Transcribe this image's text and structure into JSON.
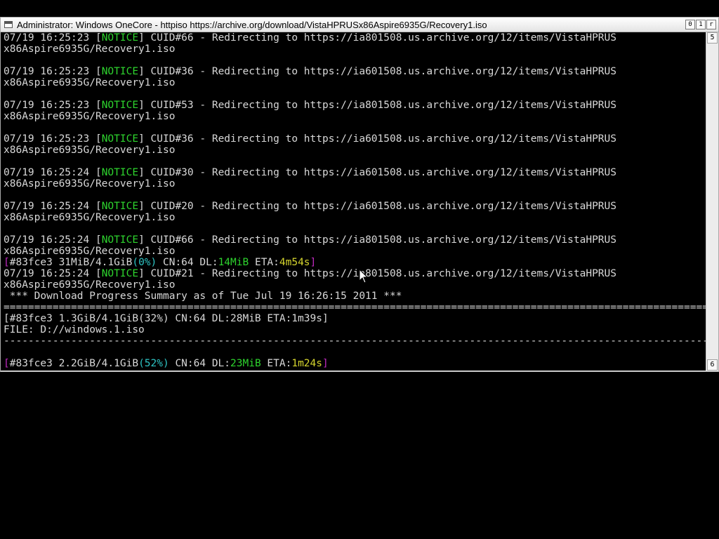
{
  "window": {
    "title": "Administrator:  Windows OneCore - httpiso  https://archive.org/download/VistaHPRUSx86Aspire6935G/Recovery1.iso",
    "minimize_glyph": "0",
    "maximize_glyph": "1",
    "close_glyph": "r"
  },
  "scrollbar": {
    "up_glyph": "5",
    "down_glyph": "6"
  },
  "console": {
    "lines": [
      [
        [
          "07/19 16:25:23 [",
          ""
        ],
        [
          "NOTICE",
          "g"
        ],
        [
          "] CUID#66 - Redirecting to https://ia801508.us.archive.org/12/items/VistaHPRUS",
          ""
        ]
      ],
      [
        [
          "x86Aspire6935G/Recovery1.iso",
          ""
        ]
      ],
      [],
      [
        [
          "07/19 16:25:23 [",
          ""
        ],
        [
          "NOTICE",
          "g"
        ],
        [
          "] CUID#36 - Redirecting to https://ia601508.us.archive.org/12/items/VistaHPRUS",
          ""
        ]
      ],
      [
        [
          "x86Aspire6935G/Recovery1.iso",
          ""
        ]
      ],
      [],
      [
        [
          "07/19 16:25:23 [",
          ""
        ],
        [
          "NOTICE",
          "g"
        ],
        [
          "] CUID#53 - Redirecting to https://ia801508.us.archive.org/12/items/VistaHPRUS",
          ""
        ]
      ],
      [
        [
          "x86Aspire6935G/Recovery1.iso",
          ""
        ]
      ],
      [],
      [
        [
          "07/19 16:25:23 [",
          ""
        ],
        [
          "NOTICE",
          "g"
        ],
        [
          "] CUID#36 - Redirecting to https://ia601508.us.archive.org/12/items/VistaHPRUS",
          ""
        ]
      ],
      [
        [
          "x86Aspire6935G/Recovery1.iso",
          ""
        ]
      ],
      [],
      [
        [
          "07/19 16:25:24 [",
          ""
        ],
        [
          "NOTICE",
          "g"
        ],
        [
          "] CUID#30 - Redirecting to https://ia601508.us.archive.org/12/items/VistaHPRUS",
          ""
        ]
      ],
      [
        [
          "x86Aspire6935G/Recovery1.iso",
          ""
        ]
      ],
      [],
      [
        [
          "07/19 16:25:24 [",
          ""
        ],
        [
          "NOTICE",
          "g"
        ],
        [
          "] CUID#20 - Redirecting to https://ia601508.us.archive.org/12/items/VistaHPRUS",
          ""
        ]
      ],
      [
        [
          "x86Aspire6935G/Recovery1.iso",
          ""
        ]
      ],
      [],
      [
        [
          "07/19 16:25:24 [",
          ""
        ],
        [
          "NOTICE",
          "g"
        ],
        [
          "] CUID#66 - Redirecting to https://ia801508.us.archive.org/12/items/VistaHPRUS",
          ""
        ]
      ],
      [
        [
          "x86Aspire6935G/Recovery1.iso",
          ""
        ]
      ],
      [
        [
          "[",
          "m"
        ],
        [
          "#83fce3 31MiB/4.1GiB",
          ""
        ],
        [
          "(0%)",
          "c"
        ],
        [
          " CN:64 DL:",
          ""
        ],
        [
          "14MiB",
          "g"
        ],
        [
          " ETA:",
          ""
        ],
        [
          "4m54s",
          "y"
        ],
        [
          "]",
          "m"
        ]
      ],
      [
        [
          "07/19 16:25:24 [",
          ""
        ],
        [
          "NOTICE",
          "g"
        ],
        [
          "] CUID#21 - Redirecting to https://ia801508.us.archive.org/12/items/VistaHPRUS",
          ""
        ]
      ],
      [
        [
          "x86Aspire6935G/Recovery1.iso",
          ""
        ]
      ],
      [
        [
          " *** Download Progress Summary as of Tue Jul 19 16:26:15 2011 ***",
          ""
        ]
      ],
      [
        [
          "=======================================================================================================================",
          ""
        ]
      ],
      [
        [
          "[#83fce3 1.3GiB/4.1GiB(32%) CN:64 DL:28MiB ETA:1m39s]",
          ""
        ]
      ],
      [
        [
          "FILE: D://windows.1.iso",
          ""
        ]
      ],
      [
        [
          "-----------------------------------------------------------------------------------------------------------------------",
          ""
        ]
      ],
      [],
      [
        [
          "[",
          "m"
        ],
        [
          "#83fce3 2.2GiB/4.1GiB",
          ""
        ],
        [
          "(52%)",
          "c"
        ],
        [
          " CN:64 DL:",
          ""
        ],
        [
          "23MiB",
          "g"
        ],
        [
          " ETA:",
          ""
        ],
        [
          "1m24s",
          "y"
        ],
        [
          "]",
          "m"
        ]
      ]
    ]
  }
}
